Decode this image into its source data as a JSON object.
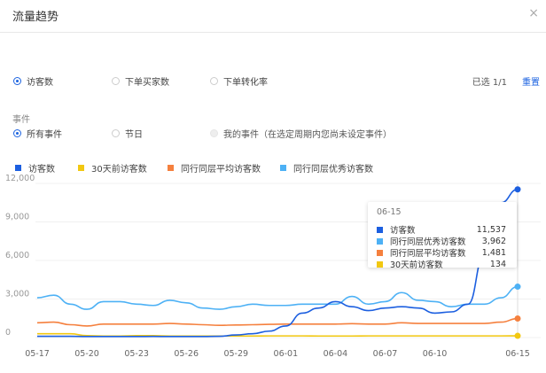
{
  "header": {
    "title": "流量趋势",
    "close": "×"
  },
  "metrics": {
    "options": [
      "访客数",
      "下单买家数",
      "下单转化率"
    ],
    "selected": 0,
    "selected_count": "已选 1/1",
    "reset": "重置"
  },
  "events": {
    "label": "事件",
    "options": [
      "所有事件",
      "节日",
      "我的事件（在选定周期内您尚未设定事件）"
    ],
    "selected": 0
  },
  "colors": {
    "visitors": "#1c5fe0",
    "ago30": "#f2c811",
    "avg": "#f5803e",
    "excellent": "#4db1f5"
  },
  "chart_data": {
    "type": "line",
    "x": [
      "05-17",
      "05-18",
      "05-19",
      "05-20",
      "05-21",
      "05-22",
      "05-23",
      "05-24",
      "05-25",
      "05-26",
      "05-27",
      "05-28",
      "05-29",
      "05-30",
      "05-31",
      "06-01",
      "06-02",
      "06-03",
      "06-04",
      "06-05",
      "06-06",
      "06-07",
      "06-08",
      "06-09",
      "06-10",
      "06-11",
      "06-12",
      "06-13",
      "06-14",
      "06-15"
    ],
    "xticks": [
      "05-17",
      "05-20",
      "05-23",
      "05-26",
      "05-29",
      "06-01",
      "06-04",
      "06-07",
      "06-10",
      "06-15"
    ],
    "yticks": [
      "12,000",
      "9,000",
      "6,000",
      "3,000",
      "0"
    ],
    "ylim": [
      0,
      12000
    ],
    "series": [
      {
        "name": "访客数",
        "color": "#1c5fe0",
        "values": [
          100,
          100,
          100,
          80,
          80,
          80,
          80,
          90,
          80,
          80,
          80,
          100,
          200,
          300,
          500,
          900,
          1900,
          2300,
          2800,
          2400,
          2100,
          2300,
          2400,
          2300,
          1900,
          2000,
          2600,
          6500,
          10500,
          11537
        ]
      },
      {
        "name": "30天前访客数",
        "color": "#f2c811",
        "values": [
          300,
          300,
          300,
          150,
          120,
          120,
          150,
          150,
          120,
          120,
          120,
          120,
          120,
          120,
          130,
          130,
          130,
          120,
          120,
          120,
          130,
          130,
          130,
          130,
          130,
          130,
          130,
          130,
          130,
          134
        ]
      },
      {
        "name": "同行同层平均访客数",
        "color": "#f5803e",
        "values": [
          1150,
          1200,
          1000,
          900,
          1050,
          1050,
          1050,
          1050,
          1100,
          1050,
          1000,
          950,
          980,
          1000,
          1030,
          1050,
          1050,
          1050,
          1050,
          1080,
          1050,
          1050,
          1150,
          1100,
          1100,
          1100,
          1100,
          1100,
          1200,
          1481
        ]
      },
      {
        "name": "同行同层优秀访客数",
        "color": "#4db1f5",
        "values": [
          3100,
          3300,
          2600,
          2200,
          2800,
          2800,
          2600,
          2500,
          2900,
          2700,
          2300,
          2200,
          2400,
          2600,
          2500,
          2500,
          2600,
          2600,
          2600,
          3200,
          2600,
          2800,
          3500,
          2900,
          2800,
          2400,
          2600,
          2600,
          3100,
          3962
        ]
      }
    ],
    "legend": [
      "访客数",
      "30天前访客数",
      "同行同层平均访客数",
      "同行同层优秀访客数"
    ],
    "legend_position": "top-left",
    "tooltip": {
      "date": "06-15",
      "rows": [
        {
          "name": "访客数",
          "value": "11,537",
          "color": "#1c5fe0"
        },
        {
          "name": "同行同层优秀访客数",
          "value": "3,962",
          "color": "#4db1f5"
        },
        {
          "name": "同行同层平均访客数",
          "value": "1,481",
          "color": "#f5803e"
        },
        {
          "name": "30天前访客数",
          "value": "134",
          "color": "#f2c811"
        }
      ]
    }
  }
}
